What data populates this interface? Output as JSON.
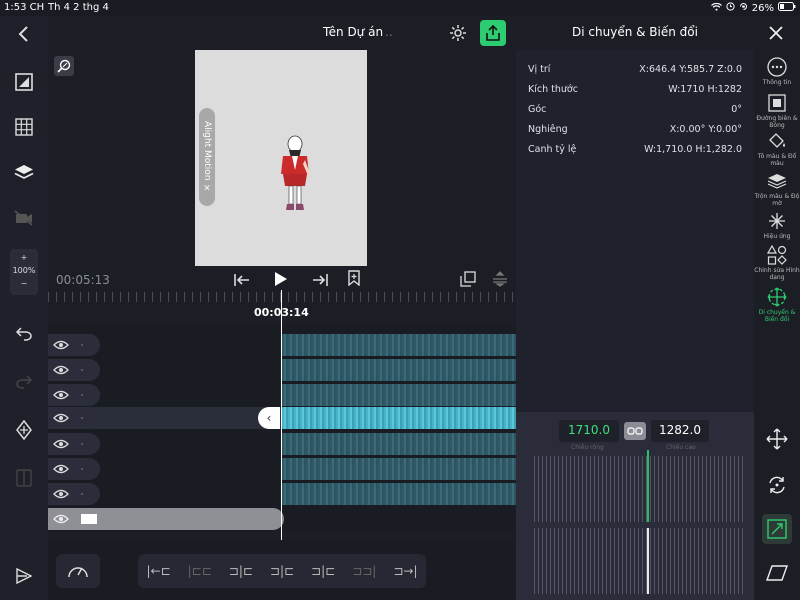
{
  "status": {
    "time": "1:53 CH",
    "date": "Th 4 2 thg 4",
    "battery": "26%"
  },
  "header": {
    "title": "Tên Dự án"
  },
  "preview": {
    "watermark": "Alight Motion ×"
  },
  "playback": {
    "timecode": "00:05:13",
    "current_time": "00:03:14"
  },
  "left_toolbar": {
    "zoom_plus": "+",
    "zoom_value": "100%",
    "zoom_minus": "−"
  },
  "panel": {
    "title": "Di chuyển & Biến đổi",
    "properties": [
      {
        "label": "Vị trí",
        "value": "X:646.4 Y:585.7 Z:0.0"
      },
      {
        "label": "Kích thước",
        "value": "W:1710 H:1282"
      },
      {
        "label": "Góc",
        "value": "0°"
      },
      {
        "label": "Nghiêng",
        "value": "X:0.00° Y:0.00°"
      },
      {
        "label": "Canh tỷ lệ",
        "value": "W:1,710.0 H:1,282.0"
      }
    ]
  },
  "right_icons": [
    {
      "label": "Thông tin"
    },
    {
      "label": "Đường biên & Bóng"
    },
    {
      "label": "Tô màu & Đổ màu"
    },
    {
      "label": "Trộn màu & Độ mờ"
    },
    {
      "label": "Hiệu ứng"
    },
    {
      "label": "Chỉnh sửa Hình dạng"
    },
    {
      "label": "Di chuyển & Biến đổi"
    }
  ],
  "editor": {
    "width_value": "1710.0",
    "height_value": "1282.0",
    "width_label": "Chiều rộng",
    "height_label": "Chiều cao"
  },
  "colors": {
    "accent": "#2ecc71",
    "selected_clip": "#5ac8d8",
    "clip": "#3a6b77"
  }
}
